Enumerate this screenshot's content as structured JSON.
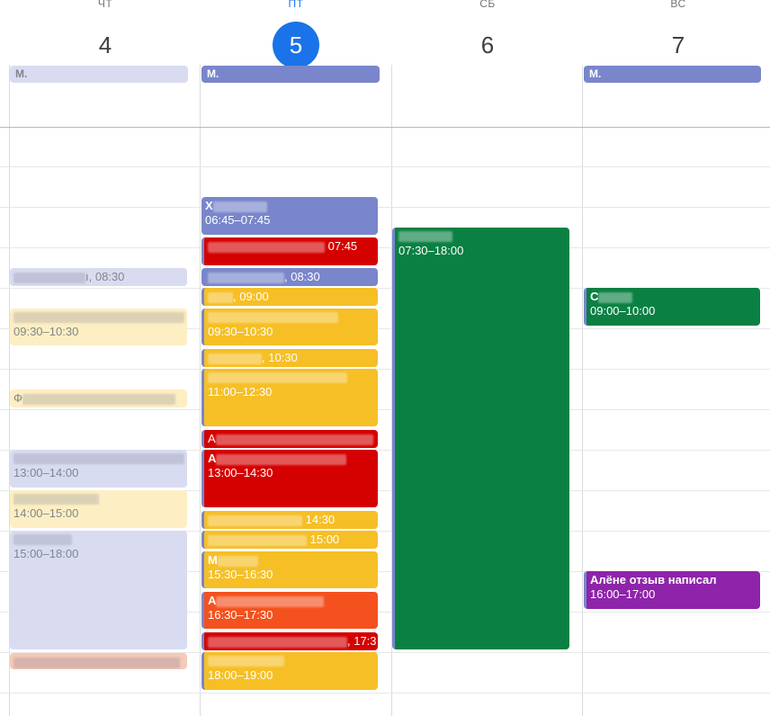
{
  "days": [
    {
      "dow": "ЧТ",
      "num": "4",
      "today": false
    },
    {
      "dow": "ПТ",
      "num": "5",
      "today": true
    },
    {
      "dow": "СБ",
      "num": "6",
      "today": false
    },
    {
      "dow": "ВС",
      "num": "7",
      "today": false
    }
  ],
  "allday": {
    "thu": "М.",
    "fri": "М.",
    "sun": "М."
  },
  "events": {
    "thu_1": "ı, 08:30",
    "thu_2_time": "09:30–10:30",
    "thu_3": "Ф",
    "thu_4_time": "13:00–14:00",
    "thu_5_time": "14:00–15:00",
    "thu_6_time": "15:00–18:00",
    "fri_1_title": "Х",
    "fri_1_time": "06:45–07:45",
    "fri_2": "07:45",
    "fri_3": ", 08:30",
    "fri_4": ", 09:00",
    "fri_5_time": "09:30–10:30",
    "fri_6": ", 10:30",
    "fri_7_time": "11:00–12:30",
    "fri_8_title": "А",
    "fri_9_title": "А",
    "fri_9_time": "13:00–14:30",
    "fri_10": "14:30",
    "fri_11": "15:00",
    "fri_12_title": "М",
    "fri_12_time": "15:30–16:30",
    "fri_13_title": "А",
    "fri_13_time": "16:30–17:30",
    "fri_14": ", 17:3",
    "fri_15_time": "18:00–19:00",
    "sat_1_time": "07:30–18:00",
    "sun_1_title": "С",
    "sun_1_time": "09:00–10:00",
    "sun_2_title": "Алёне отзыв написал",
    "sun_2_time": "16:00–17:00"
  },
  "colors": {
    "today": "#1a73e8",
    "tomato": "#d50000",
    "banana": "#f6bf26",
    "lavender": "#7986cb",
    "basil": "#0b8043",
    "tangerine": "#f4511e",
    "grape": "#8e24aa"
  }
}
